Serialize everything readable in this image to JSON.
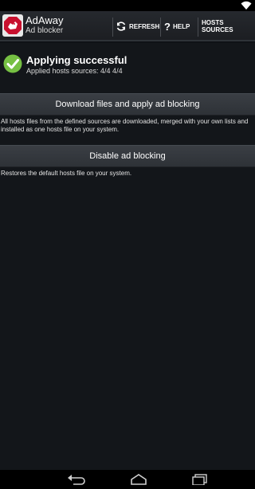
{
  "app": {
    "title": "AdAway",
    "subtitle": "Ad blocker"
  },
  "actions": [
    {
      "label": "REFRESH",
      "icon": "refresh-icon"
    },
    {
      "label": "HELP",
      "icon": "help-icon"
    },
    {
      "label": "HOSTS SOURCES"
    }
  ],
  "status": {
    "title": "Applying successful",
    "subtitle": "Applied hosts sources: 4/4 4/4",
    "icon": "check-circle-icon",
    "color": "#76c043"
  },
  "buttons": {
    "download": {
      "label": "Download files and apply ad blocking",
      "description": "All hosts files from the defined sources are downloaded, merged with your own lists and installed as one hosts file on your system.",
      "description_lines": [
        "All hosts files from the defined sources are downloaded, merged with your own lists and",
        "installed as one hosts file on your system."
      ]
    },
    "disable": {
      "label": "Disable ad blocking",
      "description": "Restores the default hosts file on your system."
    }
  },
  "colors": {
    "brand": "#c8102e",
    "background": "#13161a",
    "button": "#353a40"
  }
}
